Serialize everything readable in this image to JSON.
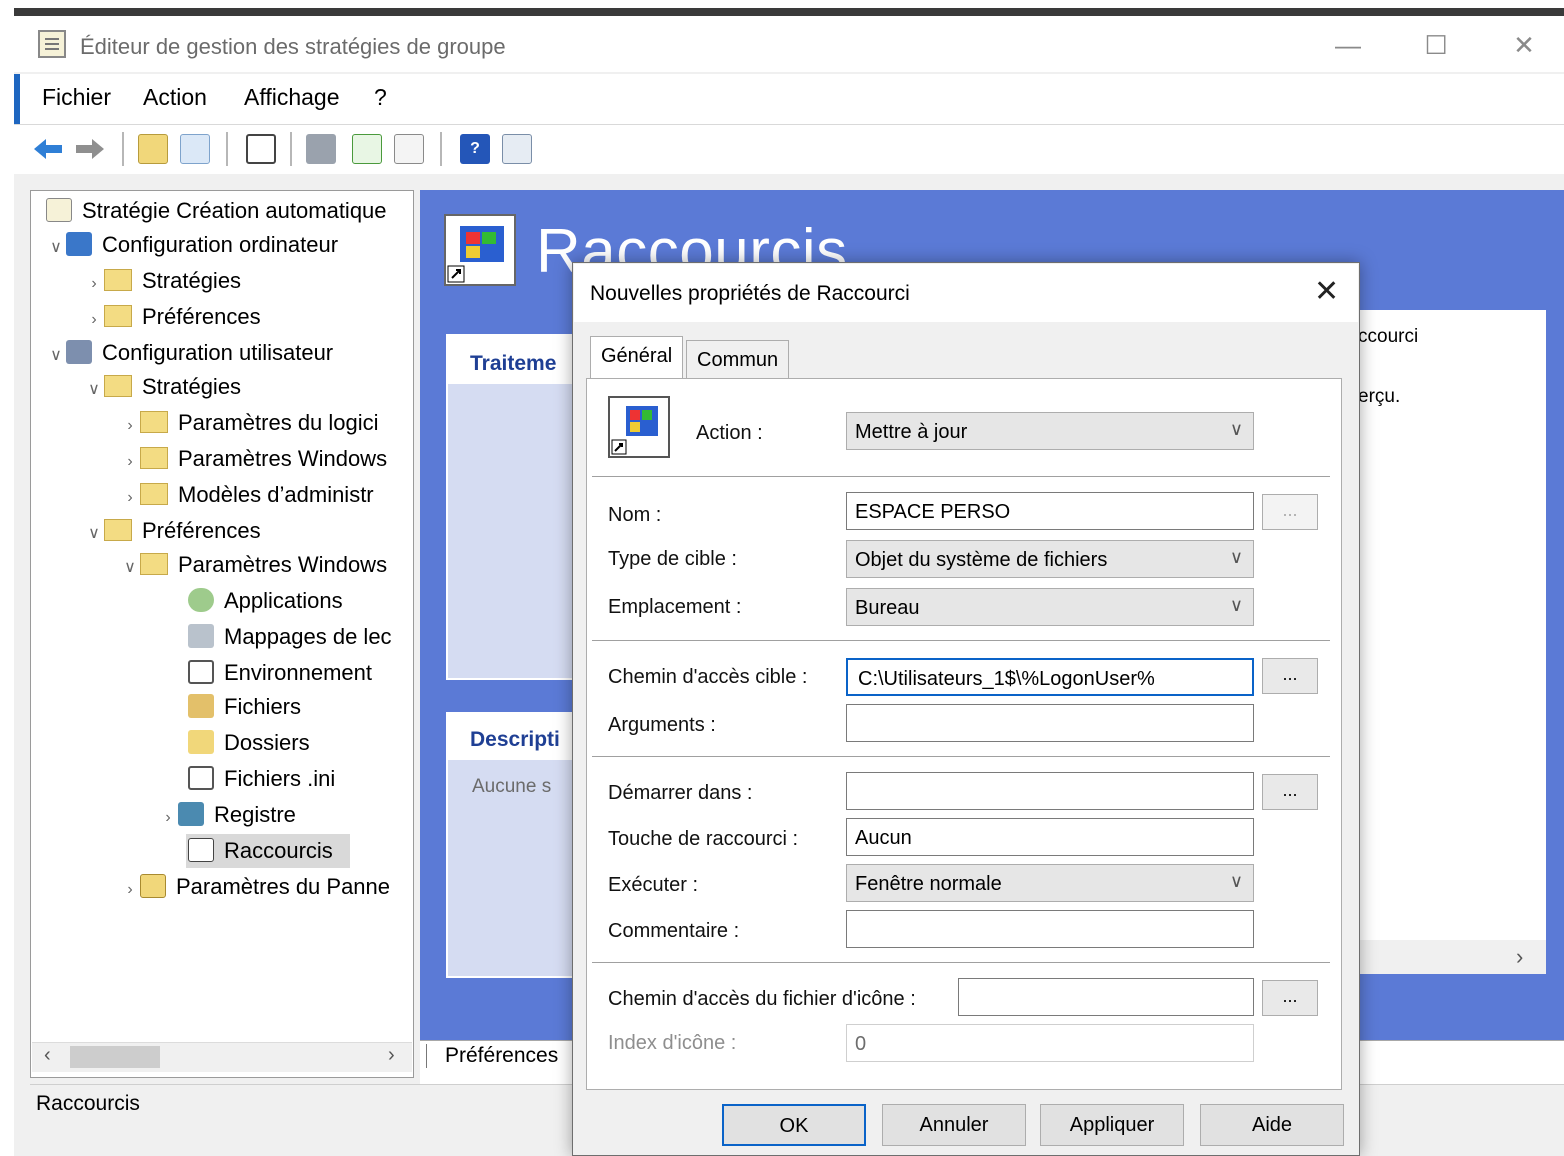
{
  "window": {
    "title": "Éditeur de gestion des stratégies de groupe",
    "controls": {
      "minimize": "—",
      "maximize": "☐",
      "close": "✕"
    }
  },
  "menu": [
    "Fichier",
    "Action",
    "Affichage",
    "?"
  ],
  "toolbar": {
    "icons": [
      "back-arrow-icon",
      "forward-arrow-icon",
      "up-folder-icon",
      "show-hide-tree-icon",
      "clipboard-icon",
      "print-icon",
      "refresh-icon",
      "export-icon",
      "help-icon",
      "properties-icon"
    ]
  },
  "tree": {
    "root": "Stratégie Création automatique",
    "computer_config": "Configuration ordinateur",
    "cc_policies": "Stratégies",
    "cc_prefs": "Préférences",
    "user_config": "Configuration utilisateur",
    "uc_policies": "Stratégies",
    "software_settings": "Paramètres du logici",
    "windows_settings": "Paramètres Windows",
    "admin_templates": "Modèles d’administr",
    "uc_prefs": "Préférences",
    "pref_windows_settings": "Paramètres Windows",
    "applications": "Applications",
    "drive_maps": "Mappages de lec",
    "environment": "Environnement",
    "files": "Fichiers",
    "folders": "Dossiers",
    "ini_files": "Fichiers .ini",
    "registry": "Registre",
    "shortcuts": "Raccourcis",
    "control_panel": "Paramètres du Panne"
  },
  "status_text": "Raccourcis",
  "right_pane": {
    "title": "Raccourcis",
    "processing_header": "Traiteme",
    "description_header": "Descripti",
    "description_body": "Aucune s",
    "side_text_1": "ccourci",
    "side_text_2": "erçu.",
    "bottom_tab": "Préférences",
    "scroll_arrow": "›"
  },
  "dialog": {
    "title": "Nouvelles propriétés de Raccourci",
    "close": "✕",
    "tabs": [
      "Général",
      "Commun"
    ],
    "action_label": "Action :",
    "action_value": "Mettre à jour",
    "name_label": "Nom :",
    "name_value": "ESPACE PERSO",
    "target_type_label": "Type de cible :",
    "target_type_value": "Objet du système de fichiers",
    "location_label": "Emplacement :",
    "location_value": "Bureau",
    "target_path_label": "Chemin d'accès cible :",
    "target_path_value": "C:\\Utilisateurs_1$\\%LogonUser%",
    "arguments_label": "Arguments :",
    "arguments_value": "",
    "start_in_label": "Démarrer dans :",
    "start_in_value": "",
    "hotkey_label": "Touche de raccourci :",
    "hotkey_value": "Aucun",
    "run_label": "Exécuter :",
    "run_value": "Fenêtre normale",
    "comment_label": "Commentaire :",
    "comment_value": "",
    "icon_path_label": "Chemin d'accès du fichier d'icône :",
    "icon_path_value": "",
    "icon_index_label": "Index d'icône :",
    "icon_index_value": "0",
    "browse": "...",
    "buttons": {
      "ok": "OK",
      "cancel": "Annuler",
      "apply": "Appliquer",
      "help": "Aide"
    }
  }
}
